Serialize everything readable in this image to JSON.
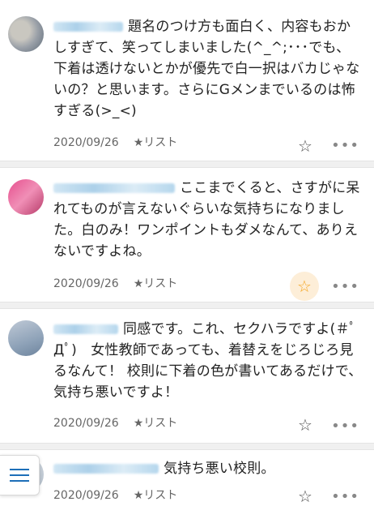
{
  "comments": [
    {
      "text": "題名のつけ方も面白く、内容もおかしすぎて、笑ってしまいました(^_^;･･･でも、下着は透けないとかが優先で白一択はバカじゃないの？と思います。さらにGメンまでいるのは怖すぎる(>_<)",
      "date": "2020/09/26",
      "list_label": "★リスト",
      "like_icon": "star-plus-icon",
      "liked": false
    },
    {
      "text": "ここまでくると、さすがに呆れてものが言えないぐらいな気持ちになりました。白のみ！ワンポイントもダメなんて、ありえないですよね。",
      "date": "2020/09/26",
      "list_label": "★リスト",
      "like_icon": "star-plus-icon",
      "liked": true,
      "liked_color": "#f5a623"
    },
    {
      "text": "同感です。これ、セクハラですよ(＃ﾟДﾟ)　女性教師であっても、着替えをじろじろ見るなんて！ 校則に下着の色が書いてあるだけで、気持ち悪いですよ！",
      "date": "2020/09/26",
      "list_label": "★リスト",
      "like_icon": "star-plus-icon",
      "liked": false
    },
    {
      "text": "気持ち悪い校則。",
      "date": "2020/09/26",
      "list_label": "★リスト",
      "like_icon": "star-plus-icon",
      "liked": false
    }
  ],
  "more_label": "•••",
  "menu_icon": "hamburger-menu-icon"
}
